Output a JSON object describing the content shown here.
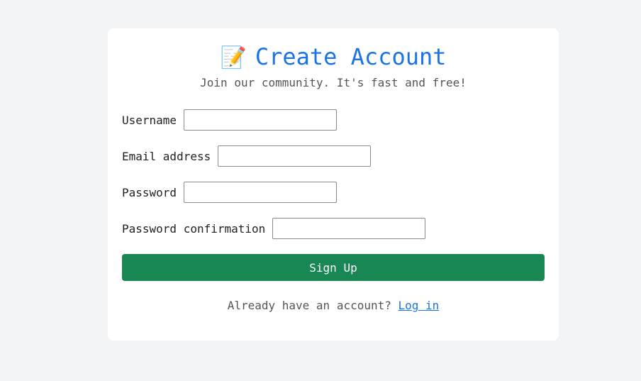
{
  "header": {
    "icon": "memo-pencil-icon",
    "title": "Create Account",
    "subtitle": "Join our community. It's fast and free!"
  },
  "form": {
    "fields": [
      {
        "label": "Username",
        "value": "",
        "placeholder": ""
      },
      {
        "label": "Email address",
        "value": "",
        "placeholder": ""
      },
      {
        "label": "Password",
        "value": "",
        "placeholder": ""
      },
      {
        "label": "Password confirmation",
        "value": "",
        "placeholder": ""
      }
    ],
    "submit_label": "Sign Up"
  },
  "footer": {
    "prompt": "Already have an account?",
    "link_label": "Log in"
  },
  "colors": {
    "accent": "#1a73e8",
    "submit": "#198754",
    "background": "#f3f4f6"
  }
}
